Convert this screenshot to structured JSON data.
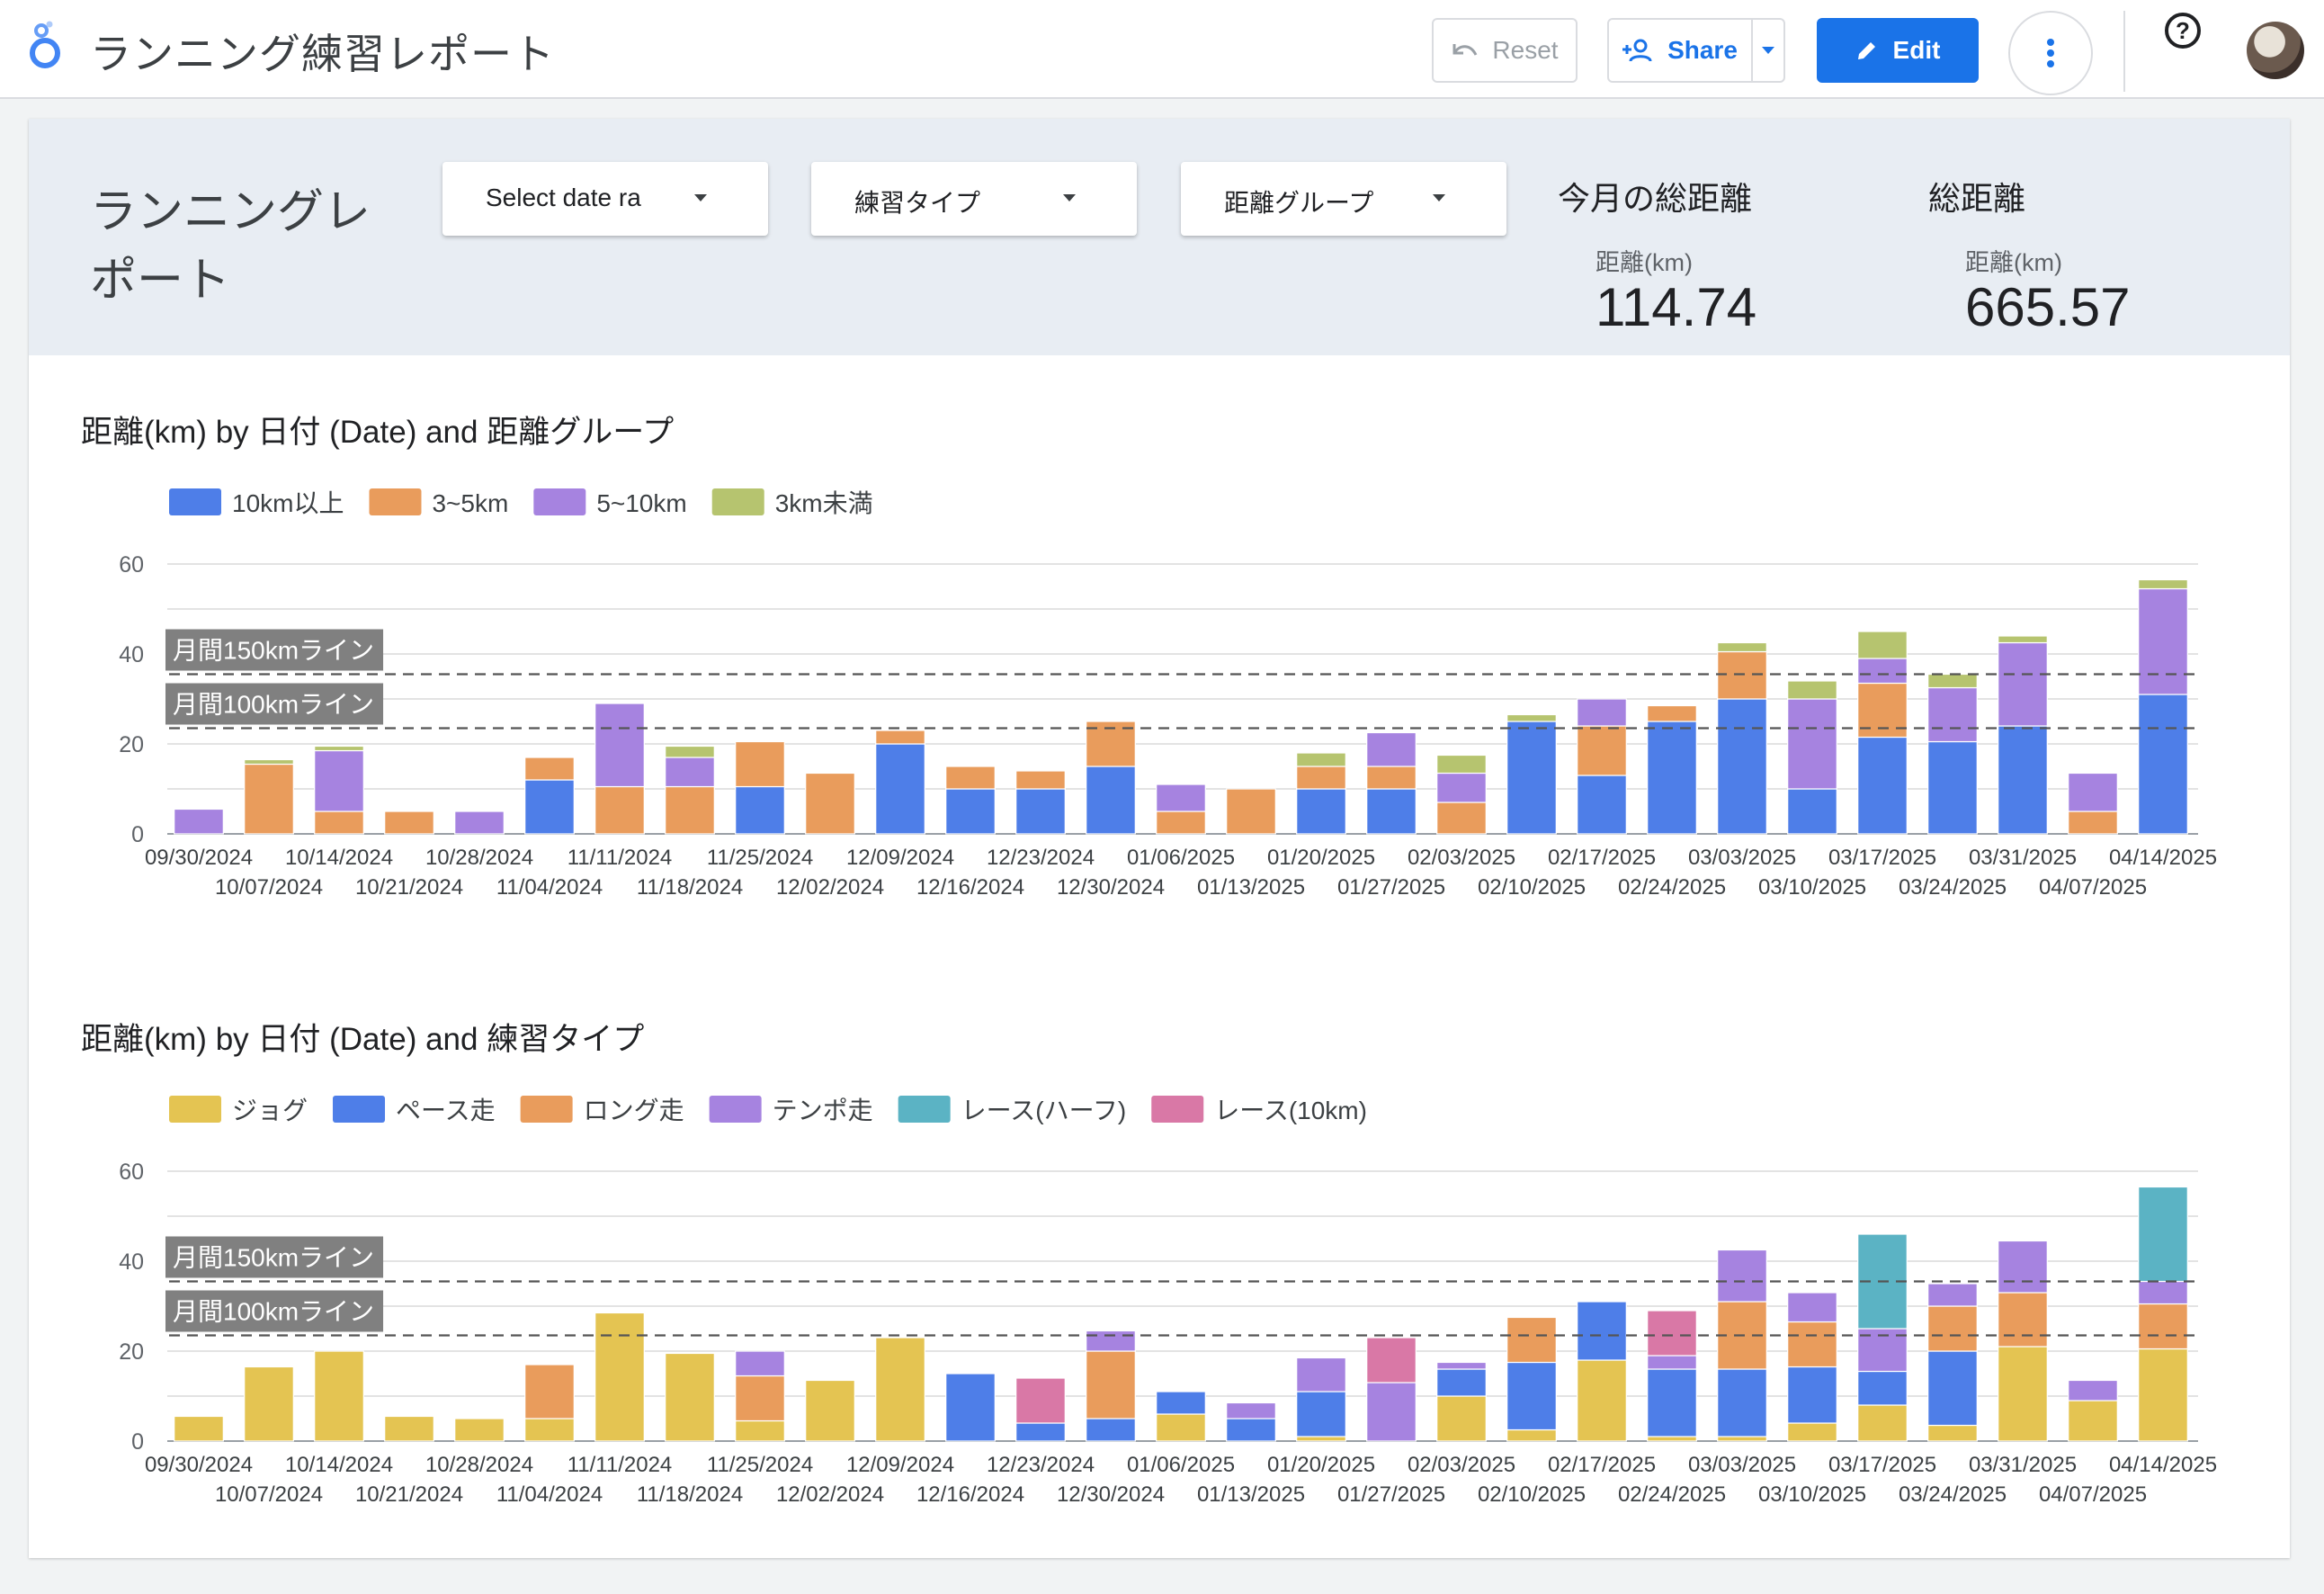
{
  "topbar": {
    "title": "ランニング練習レポート",
    "reset_label": "Reset",
    "share_label": "Share",
    "edit_label": "Edit",
    "help_label": "?"
  },
  "header": {
    "page_title": "ランニングレポート",
    "filters": [
      {
        "label": "Select date ra"
      },
      {
        "label": "練習タイプ"
      },
      {
        "label": "距離グループ"
      }
    ],
    "scorecards": [
      {
        "title": "今月の総距離",
        "metric": "距離(km)",
        "value": "114.74"
      },
      {
        "title": "総距離",
        "metric": "距離(km)",
        "value": "665.57"
      }
    ]
  },
  "colors": {
    "blue": "#4e7ee8",
    "orange": "#e99c5c",
    "purple": "#a683e0",
    "olive": "#b6c46f",
    "yellow": "#e4c452",
    "teal": "#5bb3c4",
    "pink": "#d978a6"
  },
  "chart_data": [
    {
      "type": "bar",
      "stacked": true,
      "title": "距離(km) by 日付 (Date) and 距離グループ",
      "ylim": [
        0,
        60
      ],
      "yticks": [
        "0",
        "20",
        "40",
        "60"
      ],
      "legend_position": "top-left",
      "reference_lines": [
        {
          "label": "月間150kmライン",
          "value": 35.5
        },
        {
          "label": "月間100kmライン",
          "value": 23.5
        }
      ],
      "categories": [
        "09/30/2024",
        "10/07/2024",
        "10/14/2024",
        "10/21/2024",
        "10/28/2024",
        "11/04/2024",
        "11/11/2024",
        "11/18/2024",
        "11/25/2024",
        "12/02/2024",
        "12/09/2024",
        "12/16/2024",
        "12/23/2024",
        "12/30/2024",
        "01/06/2025",
        "01/13/2025",
        "01/20/2025",
        "01/27/2025",
        "02/03/2025",
        "02/10/2025",
        "02/17/2025",
        "02/24/2025",
        "03/03/2025",
        "03/10/2025",
        "03/17/2025",
        "03/24/2025",
        "03/31/2025",
        "04/07/2025",
        "04/14/2025"
      ],
      "series": [
        {
          "name": "10km以上",
          "color": "#4e7ee8",
          "values": [
            0,
            0,
            0,
            0,
            0,
            12,
            0,
            0,
            10.5,
            0,
            20,
            10,
            10,
            15,
            0,
            0,
            10,
            10,
            0,
            25,
            13,
            25,
            30,
            10,
            21.5,
            20.5,
            24,
            0,
            31
          ]
        },
        {
          "name": "3~5km",
          "color": "#e99c5c",
          "values": [
            0,
            15.5,
            5,
            5,
            0,
            5,
            10.5,
            10.5,
            10,
            13.5,
            3,
            5,
            4,
            10,
            5,
            10,
            5,
            5,
            7,
            0,
            11,
            3.5,
            10.5,
            0,
            12,
            0,
            0,
            5,
            0
          ]
        },
        {
          "name": "5~10km",
          "color": "#a683e0",
          "values": [
            5.5,
            0,
            13.5,
            0,
            5,
            0,
            18.5,
            6.5,
            0,
            0,
            0,
            0,
            0,
            0,
            6,
            0,
            0,
            7.5,
            6.5,
            0,
            6,
            0,
            0,
            20,
            5.5,
            12,
            18.5,
            8.5,
            23.5
          ]
        },
        {
          "name": "3km未満",
          "color": "#b6c46f",
          "values": [
            0,
            1,
            1,
            0,
            0,
            0,
            0,
            2.5,
            0,
            0,
            0,
            0,
            0,
            0,
            0,
            0,
            3,
            0,
            4,
            1.5,
            0,
            0,
            2,
            4,
            6,
            3,
            1.5,
            0,
            2
          ]
        }
      ]
    },
    {
      "type": "bar",
      "stacked": true,
      "title": "距離(km) by 日付 (Date) and 練習タイプ",
      "ylim": [
        0,
        60
      ],
      "yticks": [
        "0",
        "20",
        "40",
        "60"
      ],
      "legend_position": "top-left",
      "reference_lines": [
        {
          "label": "月間150kmライン",
          "value": 35.5
        },
        {
          "label": "月間100kmライン",
          "value": 23.5
        }
      ],
      "categories": [
        "09/30/2024",
        "10/07/2024",
        "10/14/2024",
        "10/21/2024",
        "10/28/2024",
        "11/04/2024",
        "11/11/2024",
        "11/18/2024",
        "11/25/2024",
        "12/02/2024",
        "12/09/2024",
        "12/16/2024",
        "12/23/2024",
        "12/30/2024",
        "01/06/2025",
        "01/13/2025",
        "01/20/2025",
        "01/27/2025",
        "02/03/2025",
        "02/10/2025",
        "02/17/2025",
        "02/24/2025",
        "03/03/2025",
        "03/10/2025",
        "03/17/2025",
        "03/24/2025",
        "03/31/2025",
        "04/07/2025",
        "04/14/2025"
      ],
      "series": [
        {
          "name": "ジョグ",
          "color": "#e4c452",
          "values": [
            5.5,
            16.5,
            20,
            5.5,
            5,
            5,
            28.5,
            19.5,
            4.5,
            13.5,
            23,
            0,
            0,
            0,
            6,
            0,
            1,
            0,
            10,
            2.5,
            18,
            1,
            1,
            4,
            8,
            3.5,
            21,
            9,
            20.5
          ]
        },
        {
          "name": "ペース走",
          "color": "#4e7ee8",
          "values": [
            0,
            0,
            0,
            0,
            0,
            0,
            0,
            0,
            0,
            0,
            0,
            15,
            4,
            5,
            5,
            5,
            10,
            0,
            6,
            15,
            13,
            15,
            15,
            12.5,
            7.5,
            16.5,
            0,
            0,
            0
          ]
        },
        {
          "name": "ロング走",
          "color": "#e99c5c",
          "values": [
            0,
            0,
            0,
            0,
            0,
            12,
            0,
            0,
            10,
            0,
            0,
            0,
            0,
            15,
            0,
            0,
            0,
            0,
            0,
            10,
            0,
            0,
            15,
            10,
            0,
            10,
            12,
            0,
            10
          ]
        },
        {
          "name": "テンポ走",
          "color": "#a683e0",
          "values": [
            0,
            0,
            0,
            0,
            0,
            0,
            0,
            0,
            5.5,
            0,
            0,
            0,
            0,
            4.5,
            0,
            3.5,
            7.5,
            13,
            1.5,
            0,
            0,
            3,
            11.5,
            6.5,
            9.5,
            5,
            11.5,
            4.5,
            5
          ]
        },
        {
          "name": "レース(ハーフ)",
          "color": "#5bb3c4",
          "values": [
            0,
            0,
            0,
            0,
            0,
            0,
            0,
            0,
            0,
            0,
            0,
            0,
            0,
            0,
            0,
            0,
            0,
            0,
            0,
            0,
            0,
            0,
            0,
            0,
            21,
            0,
            0,
            0,
            21
          ]
        },
        {
          "name": "レース(10km)",
          "color": "#d978a6",
          "values": [
            0,
            0,
            0,
            0,
            0,
            0,
            0,
            0,
            0,
            0,
            0,
            0,
            10,
            0,
            0,
            0,
            0,
            10,
            0,
            0,
            0,
            10,
            0,
            0,
            0,
            0,
            0,
            0,
            0
          ]
        }
      ]
    }
  ]
}
